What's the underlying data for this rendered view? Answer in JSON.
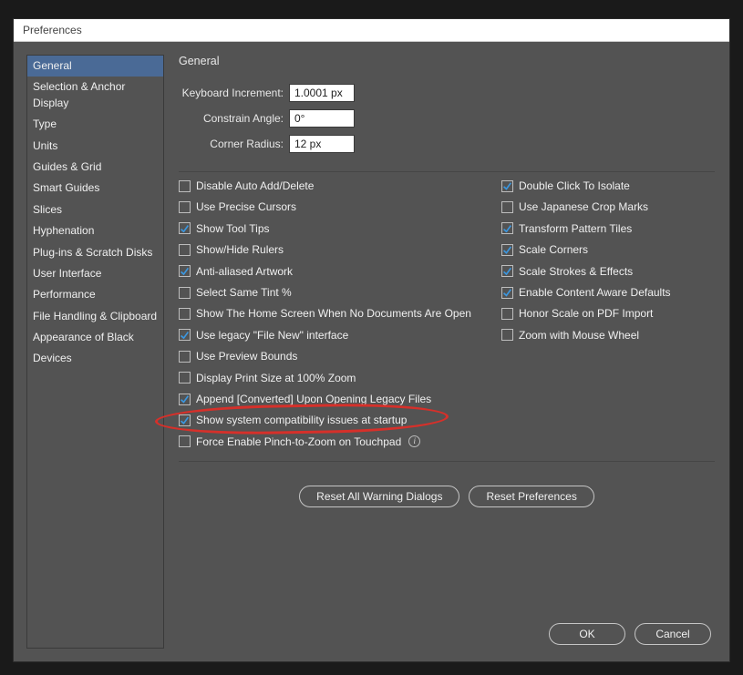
{
  "window": {
    "title": "Preferences"
  },
  "sidebar": {
    "items": [
      "General",
      "Selection & Anchor Display",
      "Type",
      "Units",
      "Guides & Grid",
      "Smart Guides",
      "Slices",
      "Hyphenation",
      "Plug-ins & Scratch Disks",
      "User Interface",
      "Performance",
      "File Handling & Clipboard",
      "Appearance of Black",
      "Devices"
    ],
    "selectedIndex": 0
  },
  "section": {
    "title": "General"
  },
  "form": {
    "keyboardIncrement": {
      "label": "Keyboard Increment:",
      "value": "1.0001 px"
    },
    "constrainAngle": {
      "label": "Constrain Angle:",
      "value": "0°"
    },
    "cornerRadius": {
      "label": "Corner Radius:",
      "value": "12 px"
    }
  },
  "checksLeft": [
    {
      "label": "Disable Auto Add/Delete",
      "checked": false
    },
    {
      "label": "Use Precise Cursors",
      "checked": false
    },
    {
      "label": "Show Tool Tips",
      "checked": true
    },
    {
      "label": "Show/Hide Rulers",
      "checked": false
    },
    {
      "label": "Anti-aliased Artwork",
      "checked": true
    },
    {
      "label": "Select Same Tint %",
      "checked": false
    },
    {
      "label": "Show The Home Screen When No Documents Are Open",
      "checked": false
    },
    {
      "label": "Use legacy \"File New\" interface",
      "checked": true
    },
    {
      "label": "Use Preview Bounds",
      "checked": false
    },
    {
      "label": "Display Print Size at 100% Zoom",
      "checked": false
    },
    {
      "label": "Append [Converted] Upon Opening Legacy Files",
      "checked": true
    },
    {
      "label": "Show system compatibility issues at startup",
      "checked": true,
      "highlighted": true
    },
    {
      "label": "Force Enable Pinch-to-Zoom on Touchpad",
      "checked": false,
      "info": true
    }
  ],
  "checksRight": [
    {
      "label": "Double Click To Isolate",
      "checked": true
    },
    {
      "label": "Use Japanese Crop Marks",
      "checked": false
    },
    {
      "label": "Transform Pattern Tiles",
      "checked": true
    },
    {
      "label": "Scale Corners",
      "checked": true
    },
    {
      "label": "Scale Strokes & Effects",
      "checked": true
    },
    {
      "label": "Enable Content Aware Defaults",
      "checked": true
    },
    {
      "label": "Honor Scale on PDF Import",
      "checked": false
    },
    {
      "label": "Zoom with Mouse Wheel",
      "checked": false
    }
  ],
  "buttons": {
    "resetWarnings": "Reset All Warning Dialogs",
    "resetPrefs": "Reset Preferences",
    "ok": "OK",
    "cancel": "Cancel"
  }
}
